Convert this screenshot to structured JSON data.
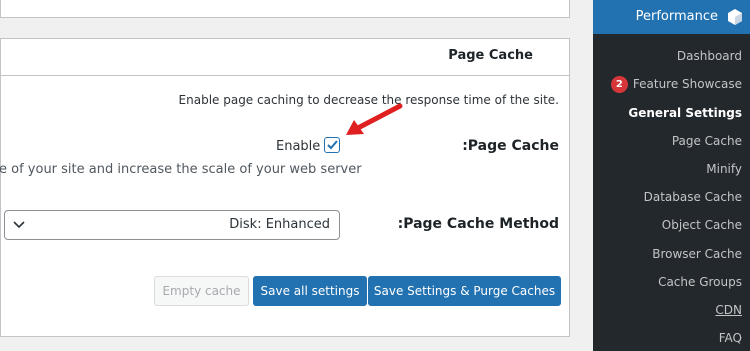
{
  "panel": {
    "title": "Page Cache",
    "description": ".Enable page caching to decrease the response time of the site",
    "page_cache_label": ":Page Cache",
    "enable_label": "Enable",
    "enable_checked": true,
    "help_text": "e of your site and increase the scale of your web server",
    "method_label": ":Page Cache Method",
    "method_value": "Disk: Enhanced",
    "buttons": {
      "empty_cache": "Empty cache",
      "save_all": "Save all settings",
      "save_purge": "Save Settings & Purge Caches"
    }
  },
  "sidebar": {
    "header": "Performance",
    "header_icon": "performance-cube-icon",
    "items": [
      {
        "label": "Dashboard"
      },
      {
        "label": "Feature Showcase",
        "badge": "2"
      },
      {
        "label": "General Settings",
        "active": true
      },
      {
        "label": "Page Cache"
      },
      {
        "label": "Minify"
      },
      {
        "label": "Database Cache"
      },
      {
        "label": "Object Cache"
      },
      {
        "label": "Browser Cache"
      },
      {
        "label": "Cache Groups"
      },
      {
        "label": "CDN"
      },
      {
        "label": "FAQ"
      }
    ]
  },
  "colors": {
    "primary": "#2271b1",
    "sidebar_bg": "#23282d",
    "badge": "#d63638",
    "annotation_arrow": "#e02020"
  }
}
